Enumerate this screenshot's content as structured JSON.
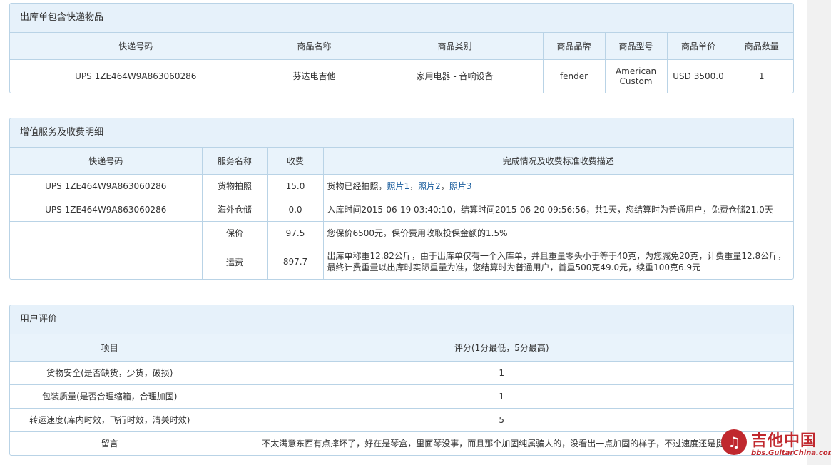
{
  "parcel_panel": {
    "title": "出库单包含快递物品",
    "headers": [
      "快递号码",
      "商品名称",
      "商品类别",
      "商品品牌",
      "商品型号",
      "商品单价",
      "商品数量"
    ],
    "row": {
      "tracking": "UPS 1ZE464W9A863060286",
      "name": "芬达电吉他",
      "category": "家用电器 - 音响设备",
      "brand": "fender",
      "model": "American Custom",
      "price": "USD 3500.0",
      "qty": "1"
    }
  },
  "service_panel": {
    "title": "增值服务及收费明细",
    "headers": [
      "快递号码",
      "服务名称",
      "收费",
      "完成情况及收费标准收费描述"
    ],
    "rows": [
      {
        "tracking": "UPS 1ZE464W9A863060286",
        "service": "货物拍照",
        "fee": "15.0",
        "desc_prefix": "货物已经拍照，",
        "photo1": "照片1",
        "sep1": "，",
        "photo2": "照片2",
        "sep2": "，",
        "photo3": "照片3"
      },
      {
        "tracking": "UPS 1ZE464W9A863060286",
        "service": "海外仓储",
        "fee": "0.0",
        "desc": "入库时间2015-06-19 03:40:10，结算时间2015-06-20 09:56:56，共1天，您结算时为普通用户，免费仓储21.0天"
      },
      {
        "tracking": "",
        "service": "保价",
        "fee": "97.5",
        "desc": "您保价6500元，保价费用收取投保金额的1.5%"
      },
      {
        "tracking": "",
        "service": "运费",
        "fee": "897.7",
        "desc": "出库单称重12.82公斤，由于出库单仅有一个入库单，并且重量零头小于等于40克，为您减免20克，计费重量12.8公斤，最终计费重量以出库时实际重量为准，您结算时为普通用户，首重500克49.0元，续重100克6.9元"
      }
    ]
  },
  "review_panel": {
    "title": "用户评价",
    "headers": [
      "项目",
      "评分(1分最低，5分最高)"
    ],
    "rows": [
      {
        "item": "货物安全(是否缺货，少货，破损)",
        "score": "1"
      },
      {
        "item": "包装质量(是否合理缩箱，合理加固)",
        "score": "1"
      },
      {
        "item": "转运速度(库内时效，飞行时效，清关时效)",
        "score": "5"
      },
      {
        "item": "留言",
        "score": "不太满意东西有点摔坏了，好在是琴盒，里面琴没事，而且那个加固纯属骗人的，没看出一点加固的样子，不过速度还是挺快的"
      }
    ]
  },
  "watermark": {
    "name": "吉他中国",
    "url": "bbs.GuitarChina.com",
    "logo_icon": "guitar-china-logo"
  }
}
